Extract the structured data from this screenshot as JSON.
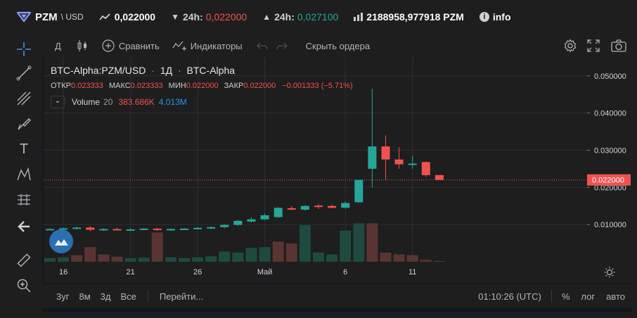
{
  "header": {
    "pair": "PZM",
    "quote": "\\ USD",
    "last_price": "0,022000",
    "low_label": "24h:",
    "low_value": "0,022000",
    "high_label": "24h:",
    "high_value": "0,027100",
    "volume_value": "2188958,977918 PZM",
    "info_label": "info",
    "colors": {
      "down": "#ef5350",
      "up": "#26a69a"
    }
  },
  "toolbar": {
    "interval": "Д",
    "compare": "Сравнить",
    "indicators": "Индикаторы",
    "hide_orders": "Скрыть ордера"
  },
  "legend": {
    "symbol": "BTC-Alpha:PZM/USD",
    "interval": "1Д",
    "exchange": "BTC-Alpha",
    "open_label": "ОТКР",
    "open": "0.023333",
    "high_label": "МАКС",
    "high": "0.023333",
    "low_label": "МИН",
    "low": "0.022000",
    "close_label": "ЗАКР",
    "close": "0.022000",
    "change": "−0.001333 (−5.71%)",
    "volume_name": "Volume",
    "volume_len": "20",
    "volume_value": "383.686K",
    "volume_ma": "4.013M"
  },
  "bottom": {
    "ranges": [
      "3уг",
      "8м",
      "3д",
      "Все"
    ],
    "goto": "Перейти...",
    "clock": "01:10:26 (UTC)",
    "percent": "%",
    "log": "лог",
    "auto": "авто"
  },
  "chart_data": {
    "type": "candlestick",
    "y_ticks": [
      "0.050000",
      "0.040000",
      "0.030000",
      "0.020000",
      "0.010000"
    ],
    "y_tick_values": [
      0.05,
      0.04,
      0.03,
      0.02,
      0.01
    ],
    "ylim": [
      0.0,
      0.0545
    ],
    "x_ticks": [
      {
        "label": "16",
        "index": 1
      },
      {
        "label": "21",
        "index": 6
      },
      {
        "label": "26",
        "index": 11
      },
      {
        "label": "Май",
        "index": 16
      },
      {
        "label": "6",
        "index": 22
      },
      {
        "label": "11",
        "index": 27
      }
    ],
    "last_price_label": "0.022000",
    "last_price": 0.022,
    "colors": {
      "up": "#26a69a",
      "down": "#ef5350",
      "up_vol": "#1f4a3f",
      "down_vol": "#5a3432"
    },
    "candles": [
      {
        "o": 0.0087,
        "h": 0.009,
        "l": 0.0085,
        "c": 0.0088
      },
      {
        "o": 0.0088,
        "h": 0.0092,
        "l": 0.0086,
        "c": 0.009
      },
      {
        "o": 0.009,
        "h": 0.0094,
        "l": 0.0087,
        "c": 0.0092
      },
      {
        "o": 0.0092,
        "h": 0.0096,
        "l": 0.0082,
        "c": 0.0086
      },
      {
        "o": 0.0086,
        "h": 0.009,
        "l": 0.0083,
        "c": 0.0088
      },
      {
        "o": 0.0088,
        "h": 0.0091,
        "l": 0.0084,
        "c": 0.0086
      },
      {
        "o": 0.0085,
        "h": 0.009,
        "l": 0.0083,
        "c": 0.0087
      },
      {
        "o": 0.0087,
        "h": 0.0091,
        "l": 0.0085,
        "c": 0.0089
      },
      {
        "o": 0.0089,
        "h": 0.0091,
        "l": 0.0083,
        "c": 0.0085
      },
      {
        "o": 0.0085,
        "h": 0.009,
        "l": 0.0083,
        "c": 0.0088
      },
      {
        "o": 0.0088,
        "h": 0.0091,
        "l": 0.0086,
        "c": 0.0089
      },
      {
        "o": 0.0089,
        "h": 0.0093,
        "l": 0.0087,
        "c": 0.0091
      },
      {
        "o": 0.0091,
        "h": 0.0095,
        "l": 0.0088,
        "c": 0.0093
      },
      {
        "o": 0.0093,
        "h": 0.0101,
        "l": 0.009,
        "c": 0.0099
      },
      {
        "o": 0.0099,
        "h": 0.0113,
        "l": 0.0097,
        "c": 0.011
      },
      {
        "o": 0.0108,
        "h": 0.012,
        "l": 0.0106,
        "c": 0.0114
      },
      {
        "o": 0.0114,
        "h": 0.013,
        "l": 0.0112,
        "c": 0.0125
      },
      {
        "o": 0.012,
        "h": 0.0147,
        "l": 0.0118,
        "c": 0.0145
      },
      {
        "o": 0.0144,
        "h": 0.015,
        "l": 0.0138,
        "c": 0.0142
      },
      {
        "o": 0.014,
        "h": 0.0152,
        "l": 0.0137,
        "c": 0.015
      },
      {
        "o": 0.0151,
        "h": 0.0155,
        "l": 0.0142,
        "c": 0.015
      },
      {
        "o": 0.015,
        "h": 0.0154,
        "l": 0.0144,
        "c": 0.0145
      },
      {
        "o": 0.0145,
        "h": 0.0162,
        "l": 0.0143,
        "c": 0.0158
      },
      {
        "o": 0.016,
        "h": 0.022,
        "l": 0.0158,
        "c": 0.022
      },
      {
        "o": 0.025,
        "h": 0.0465,
        "l": 0.02,
        "c": 0.031
      },
      {
        "o": 0.031,
        "h": 0.034,
        "l": 0.022,
        "c": 0.0275
      },
      {
        "o": 0.0275,
        "h": 0.0308,
        "l": 0.025,
        "c": 0.0262
      },
      {
        "o": 0.0262,
        "h": 0.0285,
        "l": 0.025,
        "c": 0.0264
      },
      {
        "o": 0.0268,
        "h": 0.027,
        "l": 0.0228,
        "c": 0.0233
      },
      {
        "o": 0.0233,
        "h": 0.0233,
        "l": 0.022,
        "c": 0.022
      }
    ],
    "volumes": [
      {
        "v": 0.1,
        "dir": "up"
      },
      {
        "v": 0.12,
        "dir": "up"
      },
      {
        "v": 0.18,
        "dir": "down"
      },
      {
        "v": 0.4,
        "dir": "down"
      },
      {
        "v": 0.2,
        "dir": "down"
      },
      {
        "v": 0.14,
        "dir": "down"
      },
      {
        "v": 0.1,
        "dir": "up"
      },
      {
        "v": 0.11,
        "dir": "up"
      },
      {
        "v": 0.8,
        "dir": "down"
      },
      {
        "v": 0.12,
        "dir": "up"
      },
      {
        "v": 0.1,
        "dir": "up"
      },
      {
        "v": 0.12,
        "dir": "up"
      },
      {
        "v": 0.15,
        "dir": "up"
      },
      {
        "v": 0.28,
        "dir": "up"
      },
      {
        "v": 0.25,
        "dir": "up"
      },
      {
        "v": 0.38,
        "dir": "up"
      },
      {
        "v": 0.4,
        "dir": "up"
      },
      {
        "v": 0.55,
        "dir": "down"
      },
      {
        "v": 0.5,
        "dir": "down"
      },
      {
        "v": 1.0,
        "dir": "up"
      },
      {
        "v": 0.25,
        "dir": "up"
      },
      {
        "v": 0.2,
        "dir": "up"
      },
      {
        "v": 0.85,
        "dir": "up"
      },
      {
        "v": 1.05,
        "dir": "up"
      },
      {
        "v": 1.05,
        "dir": "down"
      },
      {
        "v": 0.25,
        "dir": "down"
      },
      {
        "v": 0.2,
        "dir": "down"
      },
      {
        "v": 0.18,
        "dir": "down"
      },
      {
        "v": 0.05,
        "dir": "down"
      },
      {
        "v": 0.02,
        "dir": "down"
      }
    ]
  }
}
